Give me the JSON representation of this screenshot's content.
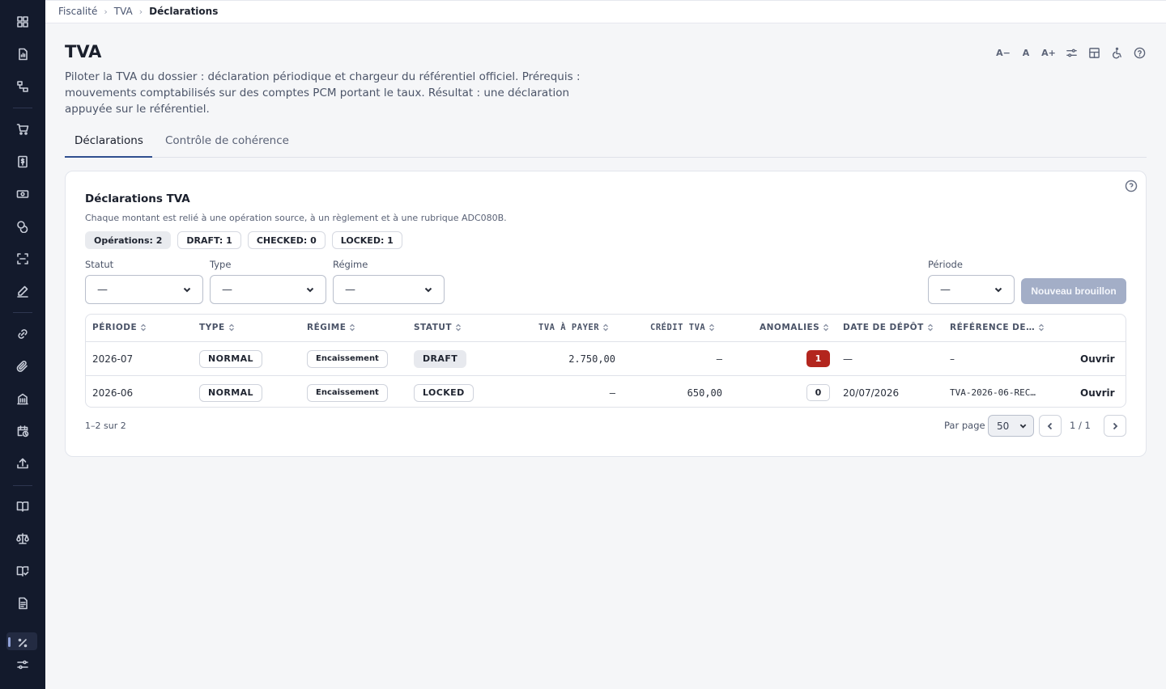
{
  "breadcrumb": {
    "items": [
      "Fiscalité",
      "TVA"
    ],
    "current": "Déclarations"
  },
  "header": {
    "title": "TVA",
    "description": "Piloter la TVA du dossier : déclaration périodique et chargeur du référentiel officiel. Prérequis : mouvements comptabilisés sur des comptes PCM portant le taux. Résultat : une déclaration appuyée sur le référentiel.",
    "tools": {
      "font_decrease": "A−",
      "font_reset": "A",
      "font_increase": "A+"
    }
  },
  "tabs": [
    {
      "label": "Déclarations",
      "active": true
    },
    {
      "label": "Contrôle de cohérence",
      "active": false
    }
  ],
  "card": {
    "title": "Déclarations TVA",
    "subtitle": "Chaque montant est relié à une opération source, à un règlement et à une rubrique ADC080B.",
    "chips": [
      "Opérations: 2",
      "DRAFT: 1",
      "CHECKED: 0",
      "LOCKED: 1"
    ],
    "filters": {
      "statut": {
        "label": "Statut",
        "value": "—"
      },
      "type": {
        "label": "Type",
        "value": "—"
      },
      "regime": {
        "label": "Régime",
        "value": "—"
      },
      "periode": {
        "label": "Période",
        "value": "—"
      }
    },
    "new_button": "Nouveau brouillon"
  },
  "table": {
    "columns": [
      "PÉRIODE",
      "TYPE",
      "RÉGIME",
      "STATUT",
      "TVA À PAYER",
      "CRÉDIT TVA",
      "ANOMALIES",
      "DATE DE DÉPÔT",
      "RÉFÉRENCE DE…"
    ],
    "rows": [
      {
        "periode": "2026-07",
        "type": "NORMAL",
        "regime": "Encaissement",
        "statut": "DRAFT",
        "tva_a_payer": "2.750,00",
        "credit_tva": "–",
        "anomalies": "1",
        "date_depot": "—",
        "reference": "–",
        "action": "Ouvrir"
      },
      {
        "periode": "2026-06",
        "type": "NORMAL",
        "regime": "Encaissement",
        "statut": "LOCKED",
        "tva_a_payer": "–",
        "credit_tva": "650,00",
        "anomalies": "0",
        "date_depot": "20/07/2026",
        "reference": "TVA-2026-06-REC…",
        "action": "Ouvrir"
      }
    ]
  },
  "pagination": {
    "count": "1–2 sur 2",
    "per_page_label": "Par page",
    "per_page": "50",
    "page": "1 / 1"
  },
  "colors": {
    "sidebar": "#131a2c",
    "accent": "#2f4f8f",
    "danger": "#b3261e",
    "button_disabled": "#a3aec7"
  }
}
